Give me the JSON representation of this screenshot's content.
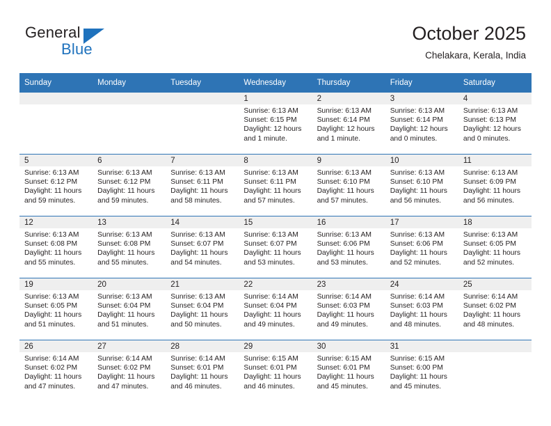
{
  "brand": {
    "name_top": "General",
    "name_bottom": "Blue",
    "accent_color": "#1f72bd"
  },
  "header": {
    "title": "October 2025",
    "subtitle": "Chelakara, Kerala, India"
  },
  "theme": {
    "header_row_color": "#2e74b5",
    "daynum_band_color": "#efefef",
    "text_color": "#231f20"
  },
  "weekday_headers": [
    "Sunday",
    "Monday",
    "Tuesday",
    "Wednesday",
    "Thursday",
    "Friday",
    "Saturday"
  ],
  "weeks": [
    [
      {
        "day": "",
        "sunrise": "",
        "sunset": "",
        "daylight_line1": "",
        "daylight_line2": ""
      },
      {
        "day": "",
        "sunrise": "",
        "sunset": "",
        "daylight_line1": "",
        "daylight_line2": ""
      },
      {
        "day": "",
        "sunrise": "",
        "sunset": "",
        "daylight_line1": "",
        "daylight_line2": ""
      },
      {
        "day": "1",
        "sunrise": "Sunrise: 6:13 AM",
        "sunset": "Sunset: 6:15 PM",
        "daylight_line1": "Daylight: 12 hours",
        "daylight_line2": "and 1 minute."
      },
      {
        "day": "2",
        "sunrise": "Sunrise: 6:13 AM",
        "sunset": "Sunset: 6:14 PM",
        "daylight_line1": "Daylight: 12 hours",
        "daylight_line2": "and 1 minute."
      },
      {
        "day": "3",
        "sunrise": "Sunrise: 6:13 AM",
        "sunset": "Sunset: 6:14 PM",
        "daylight_line1": "Daylight: 12 hours",
        "daylight_line2": "and 0 minutes."
      },
      {
        "day": "4",
        "sunrise": "Sunrise: 6:13 AM",
        "sunset": "Sunset: 6:13 PM",
        "daylight_line1": "Daylight: 12 hours",
        "daylight_line2": "and 0 minutes."
      }
    ],
    [
      {
        "day": "5",
        "sunrise": "Sunrise: 6:13 AM",
        "sunset": "Sunset: 6:12 PM",
        "daylight_line1": "Daylight: 11 hours",
        "daylight_line2": "and 59 minutes."
      },
      {
        "day": "6",
        "sunrise": "Sunrise: 6:13 AM",
        "sunset": "Sunset: 6:12 PM",
        "daylight_line1": "Daylight: 11 hours",
        "daylight_line2": "and 59 minutes."
      },
      {
        "day": "7",
        "sunrise": "Sunrise: 6:13 AM",
        "sunset": "Sunset: 6:11 PM",
        "daylight_line1": "Daylight: 11 hours",
        "daylight_line2": "and 58 minutes."
      },
      {
        "day": "8",
        "sunrise": "Sunrise: 6:13 AM",
        "sunset": "Sunset: 6:11 PM",
        "daylight_line1": "Daylight: 11 hours",
        "daylight_line2": "and 57 minutes."
      },
      {
        "day": "9",
        "sunrise": "Sunrise: 6:13 AM",
        "sunset": "Sunset: 6:10 PM",
        "daylight_line1": "Daylight: 11 hours",
        "daylight_line2": "and 57 minutes."
      },
      {
        "day": "10",
        "sunrise": "Sunrise: 6:13 AM",
        "sunset": "Sunset: 6:10 PM",
        "daylight_line1": "Daylight: 11 hours",
        "daylight_line2": "and 56 minutes."
      },
      {
        "day": "11",
        "sunrise": "Sunrise: 6:13 AM",
        "sunset": "Sunset: 6:09 PM",
        "daylight_line1": "Daylight: 11 hours",
        "daylight_line2": "and 56 minutes."
      }
    ],
    [
      {
        "day": "12",
        "sunrise": "Sunrise: 6:13 AM",
        "sunset": "Sunset: 6:08 PM",
        "daylight_line1": "Daylight: 11 hours",
        "daylight_line2": "and 55 minutes."
      },
      {
        "day": "13",
        "sunrise": "Sunrise: 6:13 AM",
        "sunset": "Sunset: 6:08 PM",
        "daylight_line1": "Daylight: 11 hours",
        "daylight_line2": "and 55 minutes."
      },
      {
        "day": "14",
        "sunrise": "Sunrise: 6:13 AM",
        "sunset": "Sunset: 6:07 PM",
        "daylight_line1": "Daylight: 11 hours",
        "daylight_line2": "and 54 minutes."
      },
      {
        "day": "15",
        "sunrise": "Sunrise: 6:13 AM",
        "sunset": "Sunset: 6:07 PM",
        "daylight_line1": "Daylight: 11 hours",
        "daylight_line2": "and 53 minutes."
      },
      {
        "day": "16",
        "sunrise": "Sunrise: 6:13 AM",
        "sunset": "Sunset: 6:06 PM",
        "daylight_line1": "Daylight: 11 hours",
        "daylight_line2": "and 53 minutes."
      },
      {
        "day": "17",
        "sunrise": "Sunrise: 6:13 AM",
        "sunset": "Sunset: 6:06 PM",
        "daylight_line1": "Daylight: 11 hours",
        "daylight_line2": "and 52 minutes."
      },
      {
        "day": "18",
        "sunrise": "Sunrise: 6:13 AM",
        "sunset": "Sunset: 6:05 PM",
        "daylight_line1": "Daylight: 11 hours",
        "daylight_line2": "and 52 minutes."
      }
    ],
    [
      {
        "day": "19",
        "sunrise": "Sunrise: 6:13 AM",
        "sunset": "Sunset: 6:05 PM",
        "daylight_line1": "Daylight: 11 hours",
        "daylight_line2": "and 51 minutes."
      },
      {
        "day": "20",
        "sunrise": "Sunrise: 6:13 AM",
        "sunset": "Sunset: 6:04 PM",
        "daylight_line1": "Daylight: 11 hours",
        "daylight_line2": "and 51 minutes."
      },
      {
        "day": "21",
        "sunrise": "Sunrise: 6:13 AM",
        "sunset": "Sunset: 6:04 PM",
        "daylight_line1": "Daylight: 11 hours",
        "daylight_line2": "and 50 minutes."
      },
      {
        "day": "22",
        "sunrise": "Sunrise: 6:14 AM",
        "sunset": "Sunset: 6:04 PM",
        "daylight_line1": "Daylight: 11 hours",
        "daylight_line2": "and 49 minutes."
      },
      {
        "day": "23",
        "sunrise": "Sunrise: 6:14 AM",
        "sunset": "Sunset: 6:03 PM",
        "daylight_line1": "Daylight: 11 hours",
        "daylight_line2": "and 49 minutes."
      },
      {
        "day": "24",
        "sunrise": "Sunrise: 6:14 AM",
        "sunset": "Sunset: 6:03 PM",
        "daylight_line1": "Daylight: 11 hours",
        "daylight_line2": "and 48 minutes."
      },
      {
        "day": "25",
        "sunrise": "Sunrise: 6:14 AM",
        "sunset": "Sunset: 6:02 PM",
        "daylight_line1": "Daylight: 11 hours",
        "daylight_line2": "and 48 minutes."
      }
    ],
    [
      {
        "day": "26",
        "sunrise": "Sunrise: 6:14 AM",
        "sunset": "Sunset: 6:02 PM",
        "daylight_line1": "Daylight: 11 hours",
        "daylight_line2": "and 47 minutes."
      },
      {
        "day": "27",
        "sunrise": "Sunrise: 6:14 AM",
        "sunset": "Sunset: 6:02 PM",
        "daylight_line1": "Daylight: 11 hours",
        "daylight_line2": "and 47 minutes."
      },
      {
        "day": "28",
        "sunrise": "Sunrise: 6:14 AM",
        "sunset": "Sunset: 6:01 PM",
        "daylight_line1": "Daylight: 11 hours",
        "daylight_line2": "and 46 minutes."
      },
      {
        "day": "29",
        "sunrise": "Sunrise: 6:15 AM",
        "sunset": "Sunset: 6:01 PM",
        "daylight_line1": "Daylight: 11 hours",
        "daylight_line2": "and 46 minutes."
      },
      {
        "day": "30",
        "sunrise": "Sunrise: 6:15 AM",
        "sunset": "Sunset: 6:01 PM",
        "daylight_line1": "Daylight: 11 hours",
        "daylight_line2": "and 45 minutes."
      },
      {
        "day": "31",
        "sunrise": "Sunrise: 6:15 AM",
        "sunset": "Sunset: 6:00 PM",
        "daylight_line1": "Daylight: 11 hours",
        "daylight_line2": "and 45 minutes."
      },
      {
        "day": "",
        "sunrise": "",
        "sunset": "",
        "daylight_line1": "",
        "daylight_line2": ""
      }
    ]
  ]
}
